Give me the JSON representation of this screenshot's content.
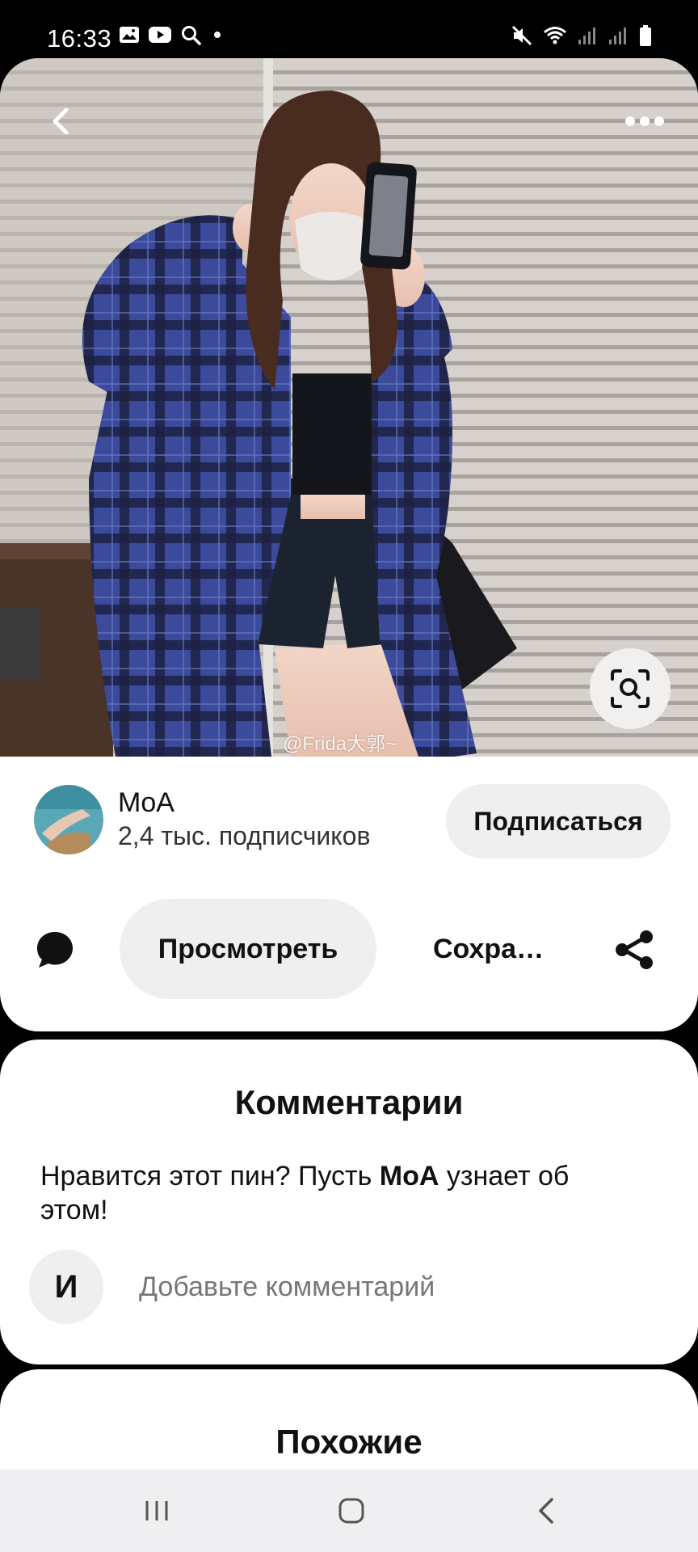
{
  "status_bar": {
    "time": "16:33",
    "left_icons": [
      "gallery-icon",
      "youtube-icon",
      "search-icon",
      "dot-icon"
    ],
    "right_icons": [
      "mute-icon",
      "wifi-icon",
      "signal-icon",
      "signal-icon",
      "battery-icon"
    ]
  },
  "pin": {
    "watermark": "@Frida大郭~",
    "actions": {
      "back_icon": "chevron-left-icon",
      "more_icon": "more-horizontal-icon",
      "lens_icon": "visual-search-icon"
    }
  },
  "creator": {
    "name": "MoA",
    "followers": "2,4 тыс. подписчиков",
    "follow_label": "Подписаться"
  },
  "actions": {
    "view_label": "Просмотреть",
    "save_label": "Сохра…"
  },
  "comments": {
    "title": "Комментарии",
    "prompt_before": "Нравится этот пин? Пусть ",
    "prompt_name": "MoA",
    "prompt_after": " узнает об этом!",
    "user_initial": "И",
    "input_placeholder": "Добавьте комментарий"
  },
  "similar": {
    "title": "Похожие"
  },
  "colors": {
    "background": "#000000",
    "card": "#ffffff",
    "button_gray": "#efefef",
    "text": "#111111",
    "placeholder": "#767676"
  }
}
